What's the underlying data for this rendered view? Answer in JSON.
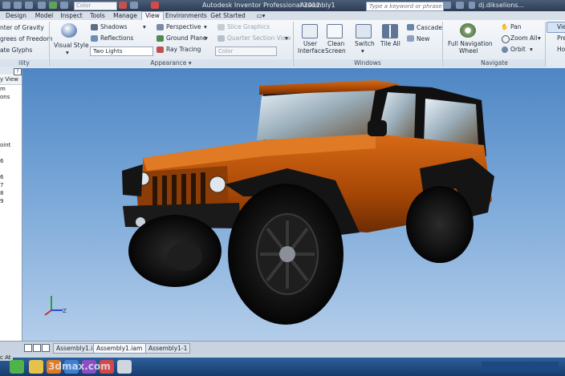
{
  "titlebar": {
    "color_combo": "Color",
    "app_title": "Autodesk Inventor Professional 2012",
    "doc_title": "Assembly1",
    "search_placeholder": "Type a keyword or phrase",
    "user": "dj.dikselions..."
  },
  "tabs": [
    "Design",
    "Model",
    "Inspect",
    "Tools",
    "Manage",
    "View",
    "Environments",
    "Get Started"
  ],
  "active_tab": "View",
  "ribbon": {
    "visibility": {
      "items": [
        "nter of Gravity",
        "grees of Freedom",
        "ate Glyphs"
      ],
      "label": "ility"
    },
    "visual_style": "Visual Style",
    "shadows": "Shadows",
    "reflections": "Reflections",
    "lights_combo": "Two Lights",
    "perspective": "Perspective",
    "ground_plane": "Ground Plane",
    "ray_tracing": "Ray Tracing",
    "slice_graphics": "Slice Graphics",
    "quarter_section": "Quarter Section View",
    "color_combo": "Color",
    "appearance_label": "Appearance",
    "user_interface": [
      "User",
      "Interface"
    ],
    "clean_screen": [
      "Clean",
      "Screen"
    ],
    "switch": "Switch",
    "tile_all": "Tile All",
    "cascade": "Cascade",
    "new": "New",
    "windows_label": "Windows",
    "full_nav": [
      "Full Navigation",
      "Wheel"
    ],
    "pan": "Pan",
    "zoom_all": "Zoom All",
    "orbit": "Orbit",
    "navigate_label": "Navigate",
    "edge": [
      "Vie",
      "Pre",
      "Ho"
    ]
  },
  "browser": {
    "view_label": "y View",
    "items": [
      "m",
      "ons",
      "",
      "",
      "",
      "",
      "",
      "oint",
      "",
      "6",
      "",
      "6",
      "7",
      "8",
      "9"
    ]
  },
  "statusbar": {
    "left": "c At"
  },
  "doc_tabs": [
    "Assembly1.iam",
    "Assembly1.iam",
    "Assembly1-1"
  ],
  "active_doc_tab": 1,
  "watermark": "3dmax.com"
}
